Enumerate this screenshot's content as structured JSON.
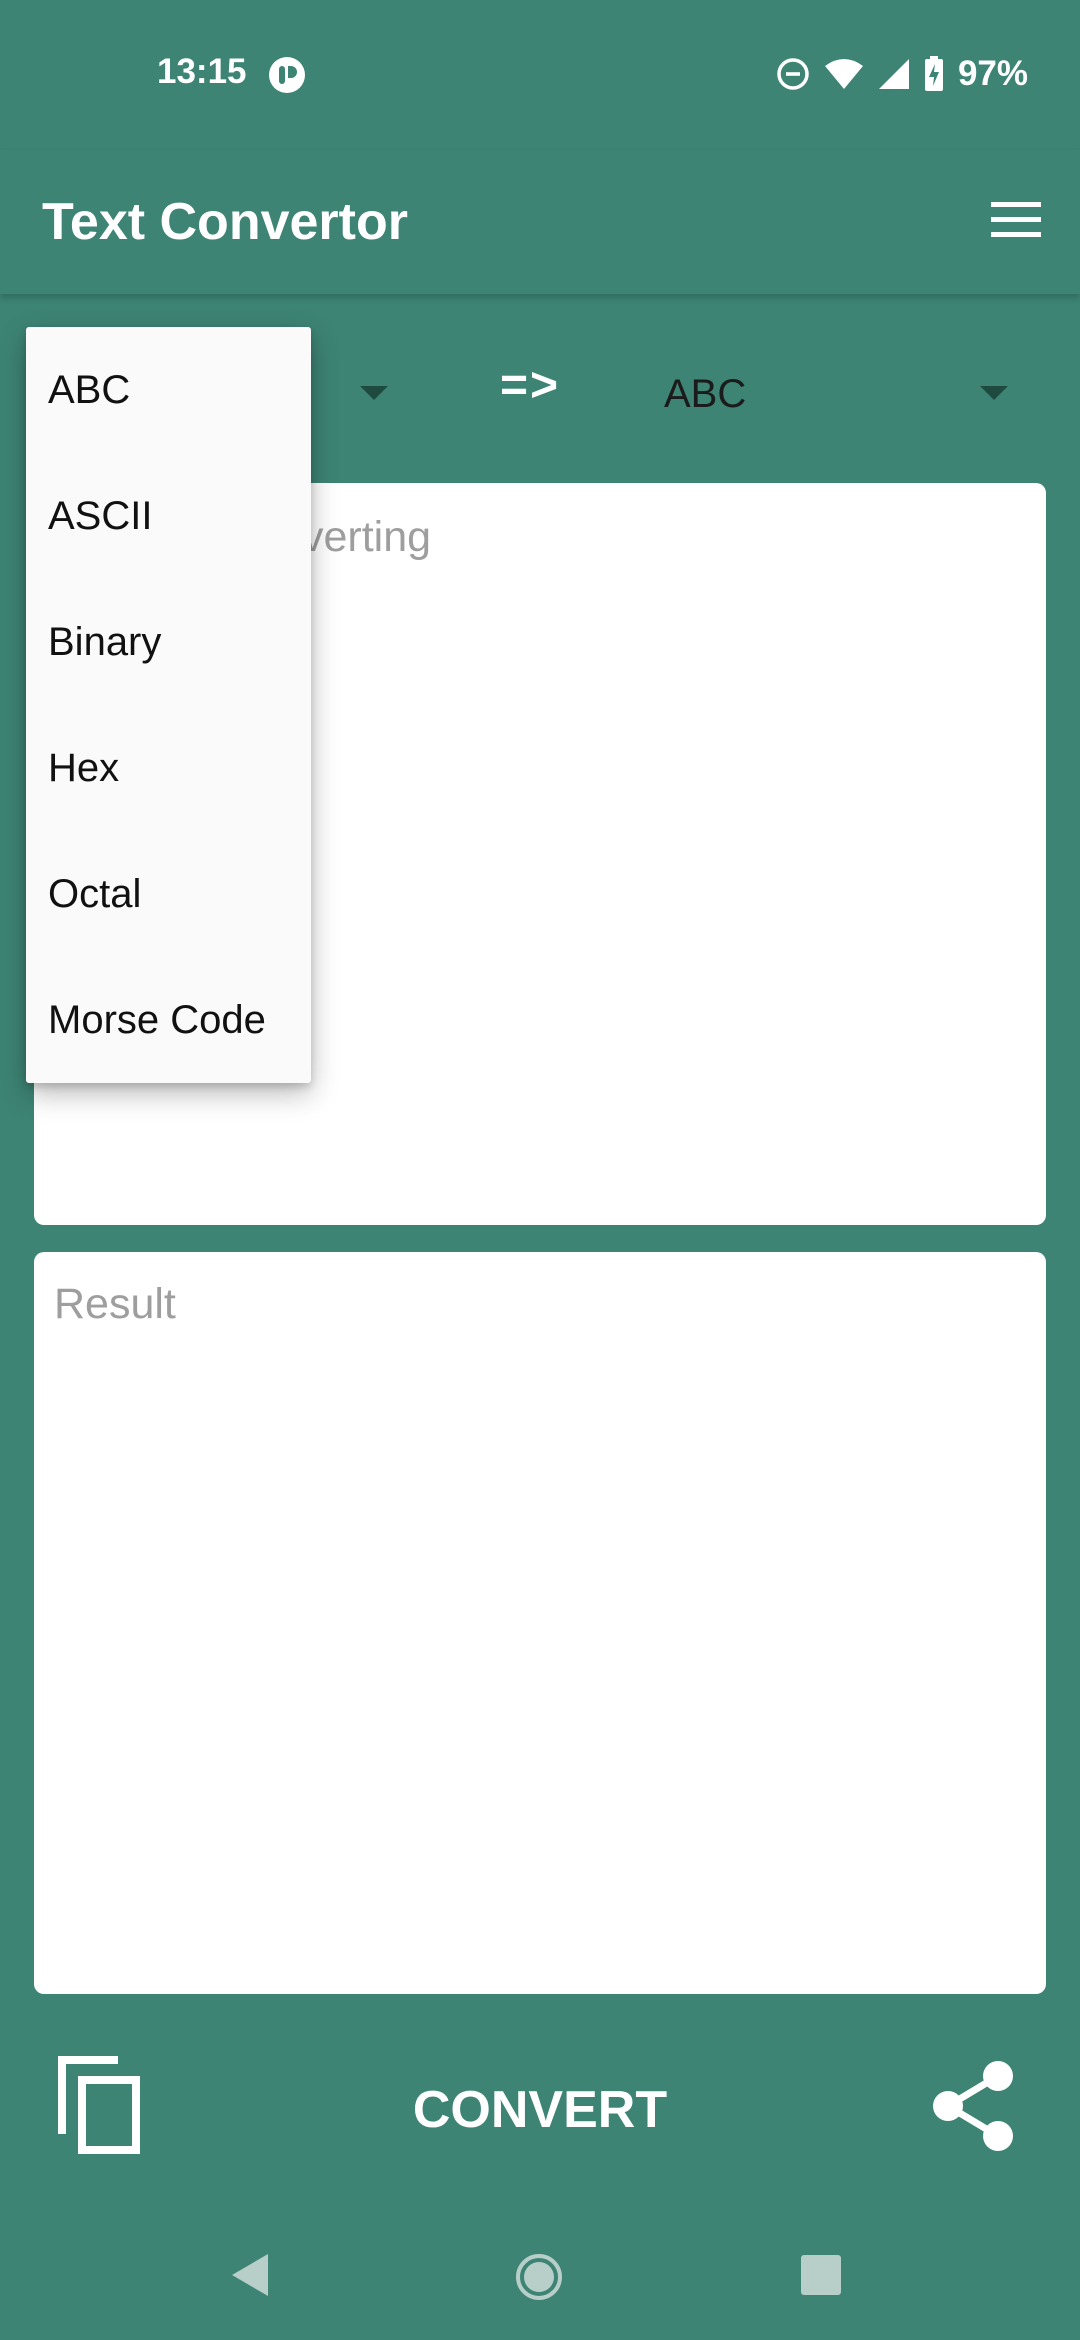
{
  "status_bar": {
    "time": "13:15",
    "battery": "97%",
    "icons": [
      "app-notification-icon",
      "do-not-disturb-icon",
      "wifi-icon",
      "cell-signal-icon",
      "battery-charging-icon"
    ]
  },
  "app_bar": {
    "title": "Text Convertor",
    "menu_icon": "hamburger-menu-icon"
  },
  "converter": {
    "swap_label": "=>",
    "to_value": "ABC"
  },
  "input": {
    "placeholder_visible": "verting"
  },
  "result": {
    "placeholder": "Result"
  },
  "actions": {
    "copy_icon": "copy-icon",
    "convert_label": "CONVERT",
    "share_icon": "share-icon"
  },
  "dropdown": {
    "options": [
      "ABC",
      "ASCII",
      "Binary",
      "Hex",
      "Octal",
      "Morse Code"
    ]
  },
  "colors": {
    "primary": "#3d8474",
    "surface": "#ffffff",
    "popup": "#fafafa",
    "placeholder": "#9e9e9e"
  }
}
